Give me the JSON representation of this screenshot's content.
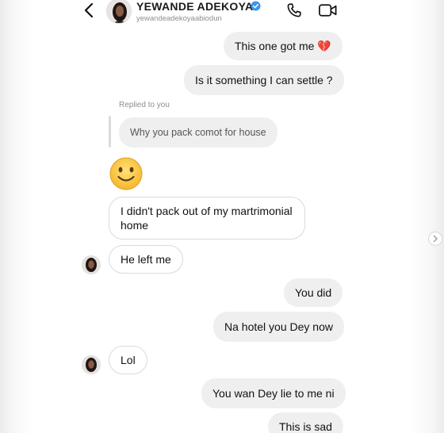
{
  "header": {
    "name": "YEWANDE ADEKOYA",
    "handle": "yewandeadekoyaabiodun",
    "icons": [
      "back-arrow-icon",
      "verified-badge-icon",
      "phone-icon",
      "video-call-icon"
    ]
  },
  "messages": [
    {
      "sender": "me",
      "text": "This one got me 💔"
    },
    {
      "sender": "me",
      "text": "Is it something I can settle ?"
    },
    {
      "sender": "them",
      "replied_label": "Replied to you",
      "quoted_text": "Why you pack comot for house"
    },
    {
      "sender": "them",
      "emoji": "slightly-smiling-face"
    },
    {
      "sender": "them",
      "text": "I didn't pack out of my martrimonial home"
    },
    {
      "sender": "them",
      "text": "He left me"
    },
    {
      "sender": "me",
      "text": "You did"
    },
    {
      "sender": "me",
      "text": "Na hotel you Dey now"
    },
    {
      "sender": "them",
      "text": "Lol"
    },
    {
      "sender": "me",
      "text": "You wan Dey lie to me ni"
    },
    {
      "sender": "me",
      "text": "This is sad"
    }
  ],
  "colors": {
    "my_bubble": "#efefef",
    "their_bubble_border": "#dbdbdb",
    "verified_blue": "#3897f0",
    "secondary_text": "#8e8e8e"
  }
}
